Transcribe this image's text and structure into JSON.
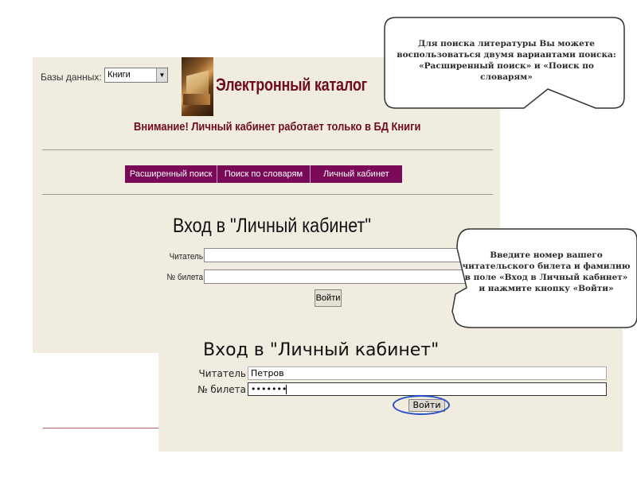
{
  "base": {
    "db_label": "Базы данных:",
    "db_value": "Книги",
    "catalog_title": "Электронный каталог",
    "warning": "Внимание! Личный кабинет работает только в БД Книги",
    "nav": [
      "Расширенный поиск",
      "Поиск по словарям",
      "Личный кабинет"
    ],
    "login_title": "Вход в \"Личный кабинет\"",
    "reader_label": "Читатель",
    "ticket_label": "№ билета",
    "login_button": "Войти"
  },
  "zoom": {
    "login_title": "Вход в \"Личный кабинет\"",
    "reader_label": "Читатель",
    "reader_value": "Петров",
    "ticket_label": "№ билета",
    "ticket_value": "•••••••",
    "login_button": "Войти"
  },
  "callouts": {
    "search_tip": "Для поиска литературы Вы можете воспользоваться двумя вариантами поиска: «Расширенный поиск» и «Поиск по словарям»",
    "login_tip": "Введите номер вашего читательского билета и фамилию в поле «Вход в Личный кабинет» и нажмите кнопку «Войти»"
  },
  "colors": {
    "page_bg": "#f1ece0",
    "title_red": "#6e0d1e",
    "nav_purple": "#7a0a57",
    "highlight_ring": "#2a50c8"
  },
  "icons": {
    "logo": "book-stack-logo",
    "dropdown": "chevron-down-icon"
  }
}
